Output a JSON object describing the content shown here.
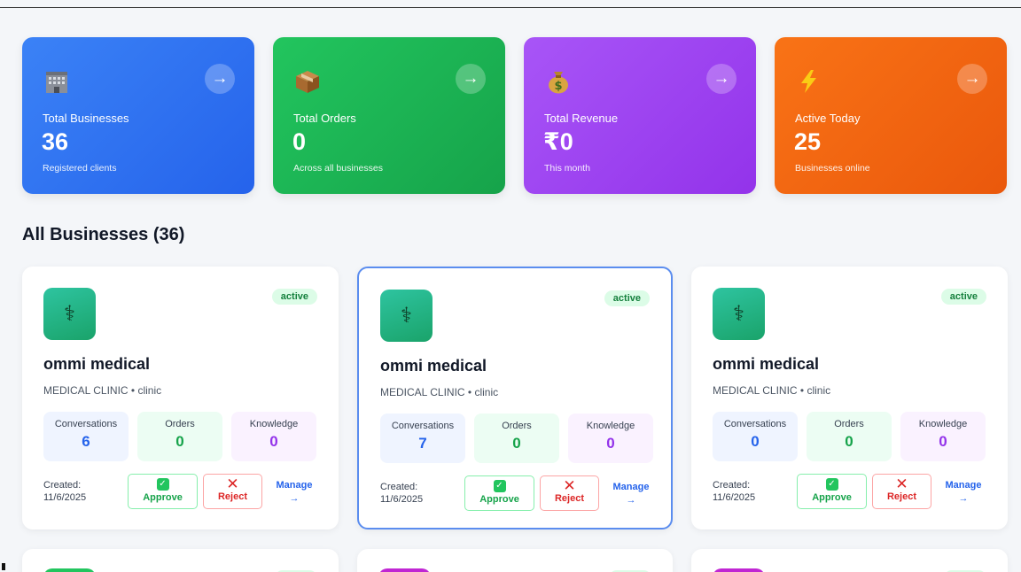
{
  "stats": [
    {
      "icon": "building-icon",
      "label": "Total Businesses",
      "value": "36",
      "sub": "Registered clients",
      "arrow": "→"
    },
    {
      "icon": "package-icon",
      "label": "Total Orders",
      "value": "0",
      "sub": "Across all businesses",
      "arrow": "→"
    },
    {
      "icon": "money-bag-icon",
      "label": "Total Revenue",
      "value": "₹0",
      "sub": "This month",
      "arrow": "→"
    },
    {
      "icon": "lightning-icon",
      "label": "Active Today",
      "value": "25",
      "sub": "Businesses online",
      "arrow": "→"
    }
  ],
  "section_title": "All Businesses (36)",
  "businesses": [
    {
      "name": "ommi medical",
      "type": "MEDICAL CLINIC • clinic",
      "status": "active",
      "logo": "⚕",
      "conversations_label": "Conversations",
      "conversations": "6",
      "orders_label": "Orders",
      "orders": "0",
      "knowledge_label": "Knowledge",
      "knowledge": "0",
      "created_label": "Created:",
      "created": "11/6/2025",
      "approve_icon": "✓",
      "approve": "Approve",
      "reject_icon": "✕",
      "reject": "Reject",
      "manage": "Manage",
      "manage_arrow": "→"
    },
    {
      "name": "ommi medical",
      "type": "MEDICAL CLINIC • clinic",
      "status": "active",
      "logo": "⚕",
      "conversations_label": "Conversations",
      "conversations": "7",
      "orders_label": "Orders",
      "orders": "0",
      "knowledge_label": "Knowledge",
      "knowledge": "0",
      "created_label": "Created:",
      "created": "11/6/2025",
      "approve_icon": "✓",
      "approve": "Approve",
      "reject_icon": "✕",
      "reject": "Reject",
      "manage": "Manage",
      "manage_arrow": "→"
    },
    {
      "name": "ommi medical",
      "type": "MEDICAL CLINIC • clinic",
      "status": "active",
      "logo": "⚕",
      "conversations_label": "Conversations",
      "conversations": "0",
      "orders_label": "Orders",
      "orders": "0",
      "knowledge_label": "Knowledge",
      "knowledge": "0",
      "created_label": "Created:",
      "created": "11/6/2025",
      "approve_icon": "✓",
      "approve": "Approve",
      "reject_icon": "✕",
      "reject": "Reject",
      "manage": "Manage",
      "manage_arrow": "→"
    }
  ],
  "colors": {
    "blue": "#2563eb",
    "green": "#16a34a",
    "purple": "#9333ea",
    "orange": "#ea580c",
    "partial_logo_1": "#22c55e",
    "partial_logo_2": "#c026d3",
    "partial_logo_3": "#c026d3"
  }
}
